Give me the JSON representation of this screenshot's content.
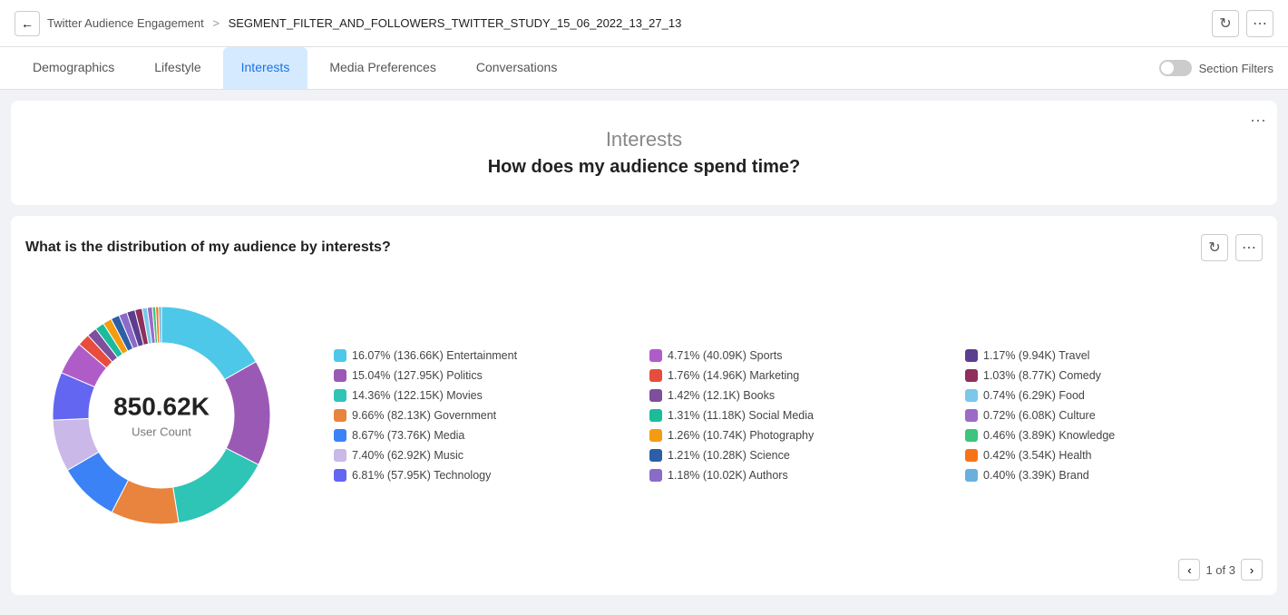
{
  "header": {
    "back_label": "←",
    "breadcrumb_parent": "Twitter Audience Engagement",
    "breadcrumb_sep": ">",
    "breadcrumb_current": "SEGMENT_FILTER_AND_FOLLOWERS_TWITTER_STUDY_15_06_2022_13_27_13",
    "refresh_icon": "↻",
    "more_icon": "⋯"
  },
  "tabs": {
    "items": [
      {
        "id": "demographics",
        "label": "Demographics",
        "active": false
      },
      {
        "id": "lifestyle",
        "label": "Lifestyle",
        "active": false
      },
      {
        "id": "interests",
        "label": "Interests",
        "active": true
      },
      {
        "id": "media-preferences",
        "label": "Media Preferences",
        "active": false
      },
      {
        "id": "conversations",
        "label": "Conversations",
        "active": false
      }
    ],
    "section_filters_label": "Section Filters"
  },
  "hero": {
    "title": "Interests",
    "subtitle": "How does my audience spend time?",
    "more_icon": "⋯"
  },
  "chart": {
    "title": "What is the distribution of my audience by interests?",
    "refresh_icon": "↻",
    "more_icon": "⋯",
    "donut": {
      "count": "850.62K",
      "label": "User Count"
    },
    "legend": [
      {
        "color": "#4dc8e8",
        "text": "16.07% (136.66K) Entertainment"
      },
      {
        "color": "#b05cc8",
        "text": "4.71% (40.09K) Sports"
      },
      {
        "color": "#5c3d8f",
        "text": "1.17% (9.94K) Travel"
      },
      {
        "color": "#9b59b6",
        "text": "15.04% (127.95K) Politics"
      },
      {
        "color": "#e74c3c",
        "text": "1.76% (14.96K) Marketing"
      },
      {
        "color": "#8e2f5c",
        "text": "1.03% (8.77K) Comedy"
      },
      {
        "color": "#2ec4b6",
        "text": "14.36% (122.15K) Movies"
      },
      {
        "color": "#7d4f9e",
        "text": "1.42% (12.1K) Books"
      },
      {
        "color": "#7bc8e8",
        "text": "0.74% (6.29K) Food"
      },
      {
        "color": "#e8843d",
        "text": "9.66% (82.13K) Government"
      },
      {
        "color": "#1abc9c",
        "text": "1.31% (11.18K) Social Media"
      },
      {
        "color": "#9b6bc7",
        "text": "0.72% (6.08K) Culture"
      },
      {
        "color": "#3b82f6",
        "text": "8.67% (73.76K) Media"
      },
      {
        "color": "#f39c12",
        "text": "1.26% (10.74K) Photography"
      },
      {
        "color": "#3dc47d",
        "text": "0.46% (3.89K) Knowledge"
      },
      {
        "color": "#c9b8e8",
        "text": "7.40% (62.92K) Music"
      },
      {
        "color": "#2c5fa8",
        "text": "1.21% (10.28K) Science"
      },
      {
        "color": "#f97316",
        "text": "0.42% (3.54K) Health"
      },
      {
        "color": "#6366f1",
        "text": "6.81% (57.95K) Technology"
      },
      {
        "color": "#8b6bc7",
        "text": "1.18% (10.02K) Authors"
      },
      {
        "color": "#6ab0de",
        "text": "0.40% (3.39K) Brand"
      }
    ],
    "segments": [
      {
        "color": "#4dc8e8",
        "percent": 16.07
      },
      {
        "color": "#9b59b6",
        "percent": 15.04
      },
      {
        "color": "#2ec4b6",
        "percent": 14.36
      },
      {
        "color": "#e8843d",
        "percent": 9.66
      },
      {
        "color": "#3b82f6",
        "percent": 8.67
      },
      {
        "color": "#c9b8e8",
        "percent": 7.4
      },
      {
        "color": "#6366f1",
        "percent": 6.81
      },
      {
        "color": "#b05cc8",
        "percent": 4.71
      },
      {
        "color": "#e74c3c",
        "percent": 1.76
      },
      {
        "color": "#7d4f9e",
        "percent": 1.42
      },
      {
        "color": "#1abc9c",
        "percent": 1.31
      },
      {
        "color": "#f39c12",
        "percent": 1.26
      },
      {
        "color": "#2c5fa8",
        "percent": 1.21
      },
      {
        "color": "#8b6bc7",
        "percent": 1.18
      },
      {
        "color": "#5c3d8f",
        "percent": 1.17
      },
      {
        "color": "#8e2f5c",
        "percent": 1.03
      },
      {
        "color": "#7bc8e8",
        "percent": 0.74
      },
      {
        "color": "#9b6bc7",
        "percent": 0.72
      },
      {
        "color": "#3dc47d",
        "percent": 0.46
      },
      {
        "color": "#f97316",
        "percent": 0.42
      },
      {
        "color": "#6ab0de",
        "percent": 0.4
      }
    ]
  },
  "pagination": {
    "current": 1,
    "total": 3,
    "label": "1 of 3",
    "prev_icon": "‹",
    "next_icon": "›"
  }
}
